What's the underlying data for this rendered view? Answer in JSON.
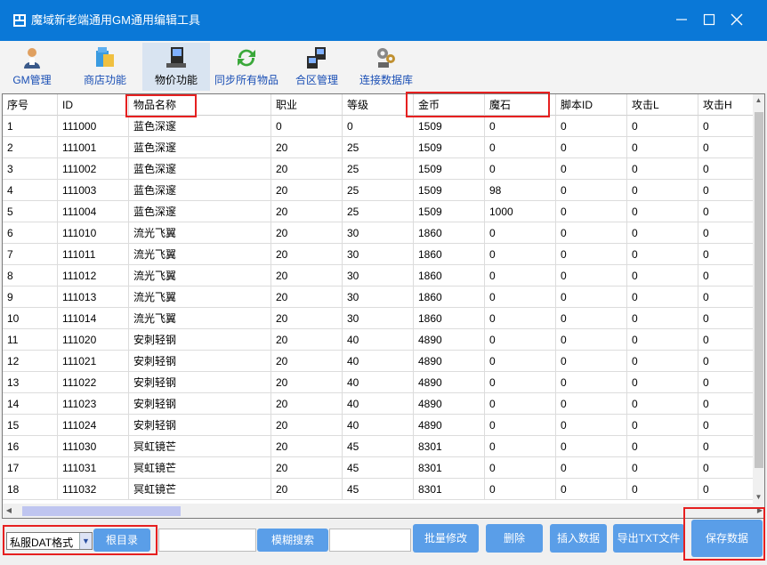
{
  "window": {
    "title": "魔域新老端通用GM通用编辑工具",
    "controls": [
      "minimize-icon",
      "maximize-icon",
      "close-icon"
    ]
  },
  "toolbar": {
    "items": [
      {
        "label": "GM管理",
        "icon": "user-icon",
        "active": false
      },
      {
        "label": "商店功能",
        "icon": "shop-icon",
        "active": false
      },
      {
        "label": "物价功能",
        "icon": "computer-icon",
        "active": true
      },
      {
        "label": "同步所有物品",
        "icon": "sync-icon",
        "active": false
      },
      {
        "label": "合区管理",
        "icon": "network-icon",
        "active": false
      },
      {
        "label": "连接数据库",
        "icon": "database-gear-icon",
        "active": false
      }
    ]
  },
  "table": {
    "columns": [
      "序号",
      "ID",
      "物品名称",
      "职业",
      "等级",
      "金币",
      "魔石",
      "脚本ID",
      "攻击L",
      "攻击H"
    ],
    "rows": [
      [
        "1",
        "111000",
        "蓝色深邃",
        "0",
        "0",
        "1509",
        "0",
        "0",
        "0",
        "0"
      ],
      [
        "2",
        "111001",
        "蓝色深邃",
        "20",
        "25",
        "1509",
        "0",
        "0",
        "0",
        "0"
      ],
      [
        "3",
        "111002",
        "蓝色深邃",
        "20",
        "25",
        "1509",
        "0",
        "0",
        "0",
        "0"
      ],
      [
        "4",
        "111003",
        "蓝色深邃",
        "20",
        "25",
        "1509",
        "98",
        "0",
        "0",
        "0"
      ],
      [
        "5",
        "111004",
        "蓝色深邃",
        "20",
        "25",
        "1509",
        "1000",
        "0",
        "0",
        "0"
      ],
      [
        "6",
        "111010",
        "流光飞翼",
        "20",
        "30",
        "1860",
        "0",
        "0",
        "0",
        "0"
      ],
      [
        "7",
        "111011",
        "流光飞翼",
        "20",
        "30",
        "1860",
        "0",
        "0",
        "0",
        "0"
      ],
      [
        "8",
        "111012",
        "流光飞翼",
        "20",
        "30",
        "1860",
        "0",
        "0",
        "0",
        "0"
      ],
      [
        "9",
        "111013",
        "流光飞翼",
        "20",
        "30",
        "1860",
        "0",
        "0",
        "0",
        "0"
      ],
      [
        "10",
        "111014",
        "流光飞翼",
        "20",
        "30",
        "1860",
        "0",
        "0",
        "0",
        "0"
      ],
      [
        "11",
        "111020",
        "安刺轻钢",
        "20",
        "40",
        "4890",
        "0",
        "0",
        "0",
        "0"
      ],
      [
        "12",
        "111021",
        "安刺轻钢",
        "20",
        "40",
        "4890",
        "0",
        "0",
        "0",
        "0"
      ],
      [
        "13",
        "111022",
        "安刺轻钢",
        "20",
        "40",
        "4890",
        "0",
        "0",
        "0",
        "0"
      ],
      [
        "14",
        "111023",
        "安刺轻钢",
        "20",
        "40",
        "4890",
        "0",
        "0",
        "0",
        "0"
      ],
      [
        "15",
        "111024",
        "安刺轻钢",
        "20",
        "40",
        "4890",
        "0",
        "0",
        "0",
        "0"
      ],
      [
        "16",
        "111030",
        "冥虹镜芒",
        "20",
        "45",
        "8301",
        "0",
        "0",
        "0",
        "0"
      ],
      [
        "17",
        "111031",
        "冥虹镜芒",
        "20",
        "45",
        "8301",
        "0",
        "0",
        "0",
        "0"
      ],
      [
        "18",
        "111032",
        "冥虹镜芒",
        "20",
        "45",
        "8301",
        "0",
        "0",
        "0",
        "0"
      ]
    ]
  },
  "bottom": {
    "format_select": "私服DAT格式",
    "root_button": "根目录",
    "root_path_value": "",
    "fuzzy_search_button": "模糊搜索",
    "search_value": "",
    "batch_edit_button": "批量修改",
    "delete_button": "删除",
    "insert_button": "插入数据",
    "export_txt_button": "导出TXT文件",
    "save_button": "保存数据"
  },
  "colors": {
    "titlebar": "#0a78d7",
    "button": "#5a9ee8",
    "highlight": "#e62020",
    "active_tool": "#d9e4f1"
  }
}
